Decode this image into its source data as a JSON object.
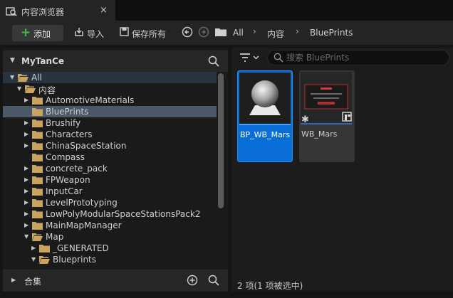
{
  "tab": {
    "title": "内容浏览器",
    "close": "×"
  },
  "toolbar": {
    "add_label": "添加",
    "import_label": "导入",
    "save_all_label": "保存所有",
    "breadcrumb": [
      "All",
      "内容",
      "BluePrints"
    ]
  },
  "left_panel": {
    "title": "MyTanCe",
    "tree": [
      {
        "label": "All"
      },
      {
        "label": "内容"
      },
      {
        "label": "AutomotiveMaterials"
      },
      {
        "label": "BluePrints"
      },
      {
        "label": "Brushify"
      },
      {
        "label": "Characters"
      },
      {
        "label": "ChinaSpaceStation"
      },
      {
        "label": "Compass"
      },
      {
        "label": "concrete_pack"
      },
      {
        "label": "FPWeapon"
      },
      {
        "label": "InputCar"
      },
      {
        "label": "LevelPrototyping"
      },
      {
        "label": "LowPolyModularSpaceStationsPack2"
      },
      {
        "label": "MainMapManager"
      },
      {
        "label": "Map"
      },
      {
        "label": "_GENERATED"
      },
      {
        "label": "Blueprints"
      }
    ],
    "collections_label": "合集"
  },
  "right_panel": {
    "search_placeholder": "搜索 BluePrints",
    "assets": [
      {
        "name": "BP_WB_Mars",
        "selected": true
      },
      {
        "name": "WB_Mars",
        "selected": false
      }
    ],
    "status": "2 项(1 项被选中)"
  },
  "colors": {
    "accent": "#0a6ed8",
    "folder": "#c9a35f",
    "add_green": "#3fbf3f"
  }
}
